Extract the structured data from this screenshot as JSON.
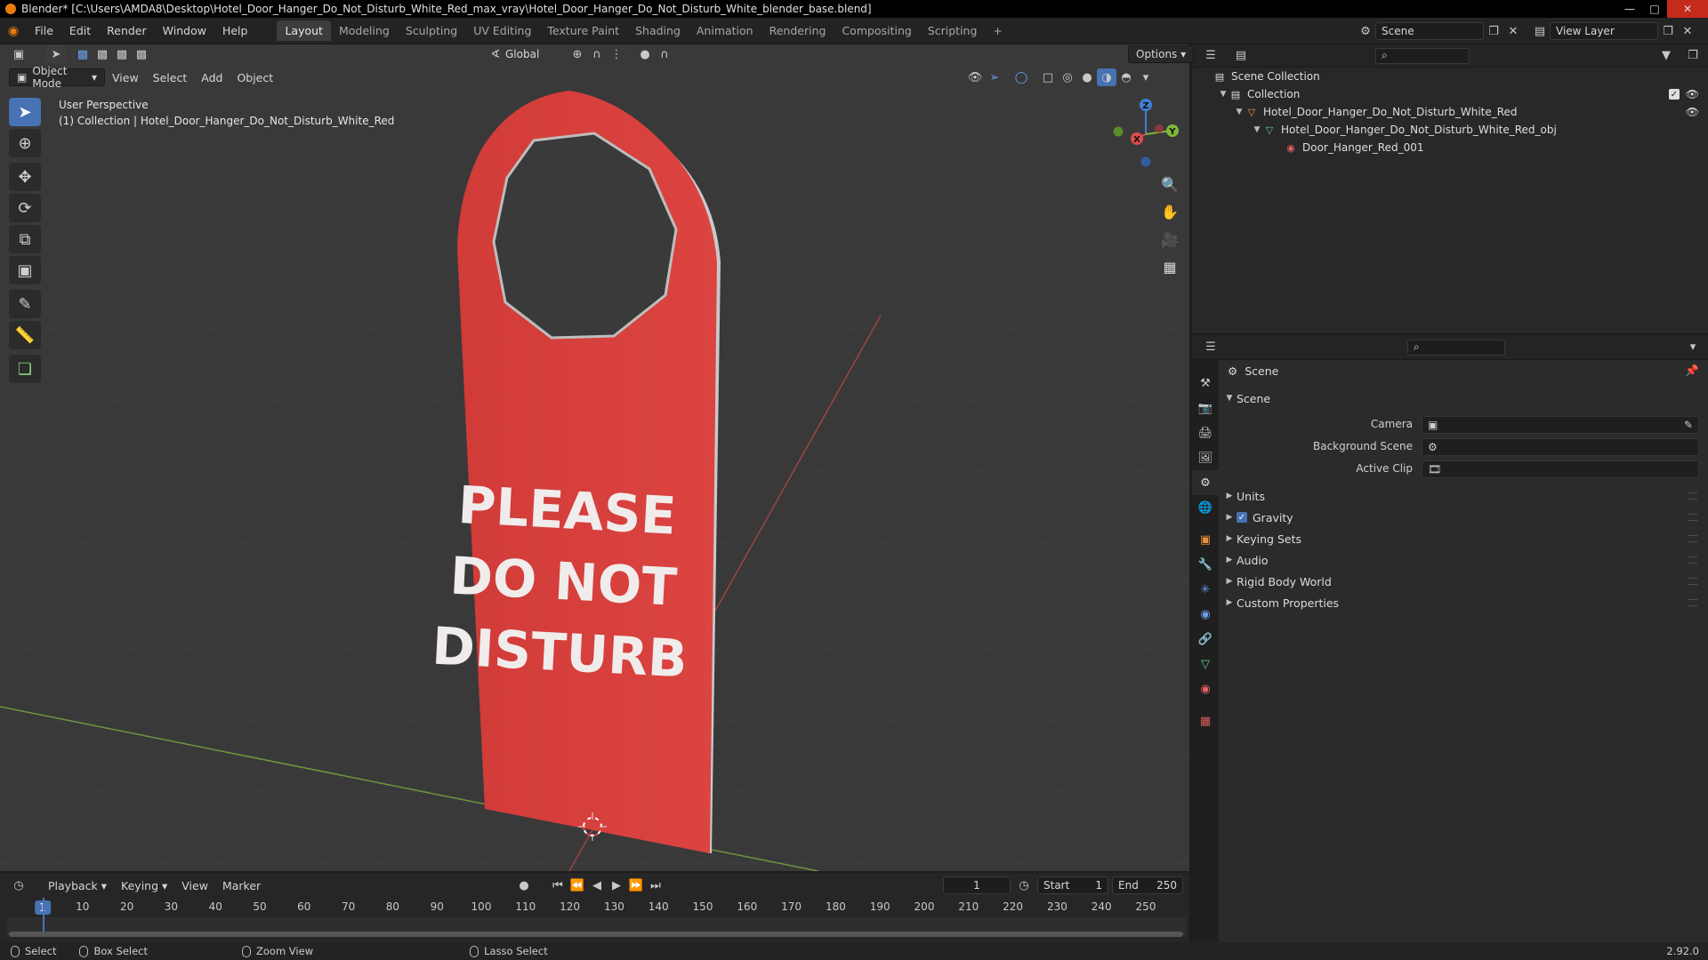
{
  "window": {
    "title": "Blender* [C:\\Users\\AMDA8\\Desktop\\Hotel_Door_Hanger_Do_Not_Disturb_White_Red_max_vray\\Hotel_Door_Hanger_Do_Not_Disturb_White_blender_base.blend]"
  },
  "menu": [
    "File",
    "Edit",
    "Render",
    "Window",
    "Help"
  ],
  "workspaces": [
    "Layout",
    "Modeling",
    "Sculpting",
    "UV Editing",
    "Texture Paint",
    "Shading",
    "Animation",
    "Rendering",
    "Compositing",
    "Scripting"
  ],
  "workspace_add": "+",
  "scene_selector": {
    "value": "Scene"
  },
  "view_layer_selector": {
    "value": "View Layer"
  },
  "viewport": {
    "mode": "Object Mode",
    "menus": [
      "View",
      "Select",
      "Add",
      "Object"
    ],
    "transform_orientation": "Global",
    "options_label": "Options",
    "info_line1": "User Perspective",
    "info_line2": "(1) Collection | Hotel_Door_Hanger_Do_Not_Disturb_White_Red",
    "model_text": [
      "PLEASE",
      "DO NOT",
      "DISTURB"
    ],
    "gizmo_axes": {
      "x": "X",
      "y": "Y",
      "z": "Z"
    },
    "colors": {
      "hanger": "#d9403d",
      "background": "#393939",
      "x_axis": "#b24a4a",
      "y_axis": "#7ea04a"
    }
  },
  "outliner": {
    "root": "Scene Collection",
    "items": [
      {
        "label": "Collection",
        "level": 0
      },
      {
        "label": "Hotel_Door_Hanger_Do_Not_Disturb_White_Red",
        "level": 1
      },
      {
        "label": "Hotel_Door_Hanger_Do_Not_Disturb_White_Red_obj",
        "level": 2
      },
      {
        "label": "Door_Hanger_Red_001",
        "level": 3
      }
    ]
  },
  "properties": {
    "context": "Scene",
    "section": "Scene",
    "fields": [
      {
        "label": "Camera",
        "value": ""
      },
      {
        "label": "Background Scene",
        "value": ""
      },
      {
        "label": "Active Clip",
        "value": ""
      }
    ],
    "panels": [
      "Units",
      "Gravity",
      "Keying Sets",
      "Audio",
      "Rigid Body World",
      "Custom Properties"
    ],
    "gravity_enabled": true
  },
  "timeline": {
    "menus": [
      "Playback",
      "Keying",
      "View",
      "Marker"
    ],
    "current_frame": "1",
    "start_label": "Start",
    "start_value": "1",
    "end_label": "End",
    "end_value": "250",
    "ticks": [
      "1",
      "10",
      "20",
      "30",
      "40",
      "50",
      "60",
      "70",
      "80",
      "90",
      "100",
      "110",
      "120",
      "130",
      "140",
      "150",
      "160",
      "170",
      "180",
      "190",
      "200",
      "210",
      "220",
      "230",
      "240",
      "250"
    ]
  },
  "statusbar": {
    "items": [
      "Select",
      "Box Select",
      "Zoom View",
      "Lasso Select"
    ],
    "version": "2.92.0"
  }
}
